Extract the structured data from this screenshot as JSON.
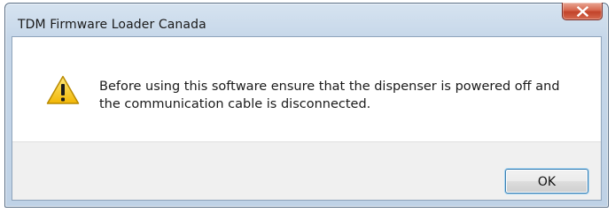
{
  "dialog": {
    "title": "TDM Firmware Loader Canada",
    "message_line1": "Before using this software ensure that the dispenser is powered off and",
    "message_line2": "the communication cable is disconnected.",
    "ok_label": "OK",
    "icon": "warning-icon",
    "close_icon": "close-icon"
  },
  "colors": {
    "title_bar": "#c6d7e9",
    "close_button": "#c2432a",
    "warning_yellow": "#f5c518",
    "button_bar": "#f0f0f0"
  }
}
